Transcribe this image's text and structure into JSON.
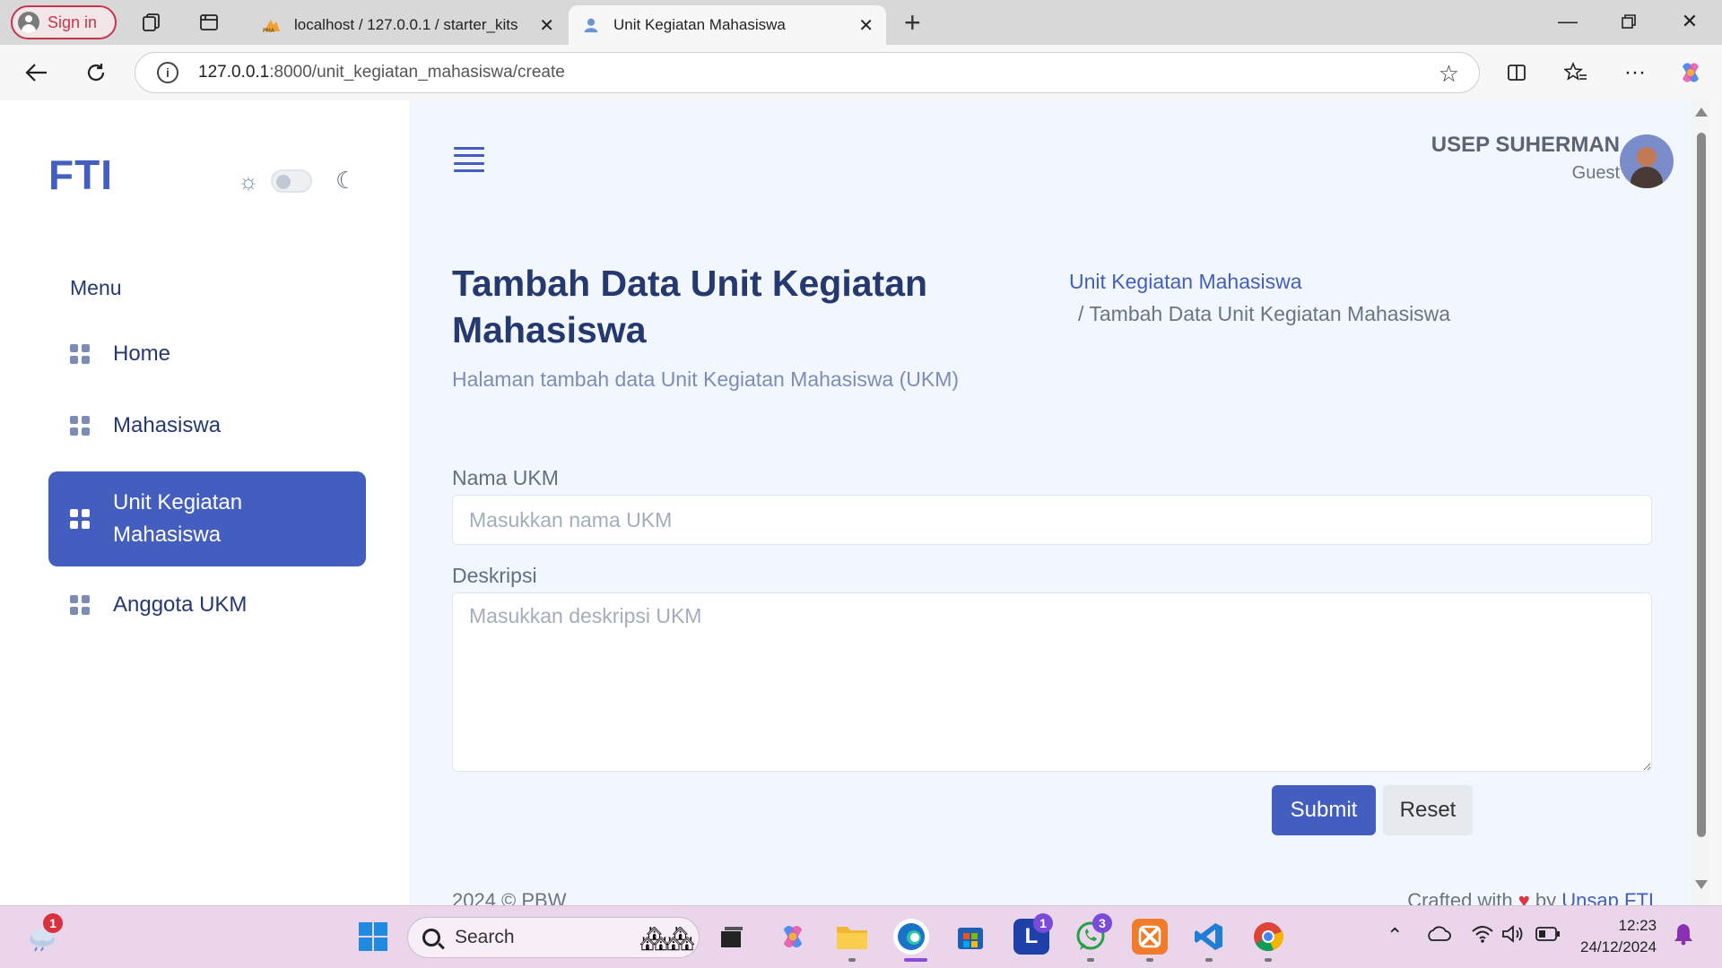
{
  "browser": {
    "signin_label": "Sign in",
    "tabs": [
      {
        "title": "localhost / 127.0.0.1 / starter_kits",
        "active": false
      },
      {
        "title": "Unit Kegiatan Mahasiswa",
        "active": true
      }
    ],
    "url_host": "127.0.0.1",
    "url_path": ":8000/unit_kegiatan_mahasiswa/create"
  },
  "sidebar": {
    "logo": "FTI",
    "menu_title": "Menu",
    "items": [
      {
        "label": "Home",
        "active": false
      },
      {
        "label": "Mahasiswa",
        "active": false
      },
      {
        "label": "Unit Kegiatan Mahasiswa",
        "active": true
      },
      {
        "label": "Anggota UKM",
        "active": false
      }
    ]
  },
  "user": {
    "name": "USEP SUHERMAN",
    "role": "Guest"
  },
  "page": {
    "title": "Tambah Data Unit Kegiatan Mahasiswa",
    "subtitle": "Halaman tambah data Unit Kegiatan Mahasiswa (UKM)",
    "breadcrumb": [
      "Unit Kegiatan Mahasiswa",
      "/  Tambah Data Unit Kegiatan Mahasiswa"
    ]
  },
  "form": {
    "nama_label": "Nama UKM",
    "nama_placeholder": "Masukkan nama UKM",
    "nama_value": "",
    "deskripsi_label": "Deskripsi",
    "deskripsi_placeholder": "Masukkan deskripsi UKM",
    "deskripsi_value": "",
    "submit_label": "Submit",
    "reset_label": "Reset"
  },
  "footer": {
    "left": "2024 © PBW",
    "right_prefix": "Crafted with",
    "right_by": "by",
    "right_link": "Unsap FTI"
  },
  "taskbar": {
    "search_label": "Search",
    "weather_badge": "1",
    "l_badge": "1",
    "whatsapp_badge": "3",
    "time": "12:23",
    "date": "24/12/2024"
  },
  "colors": {
    "primary": "#435ebe",
    "heading": "#25396f",
    "muted": "#7c8db5",
    "page_bg": "#f2f7ff"
  }
}
